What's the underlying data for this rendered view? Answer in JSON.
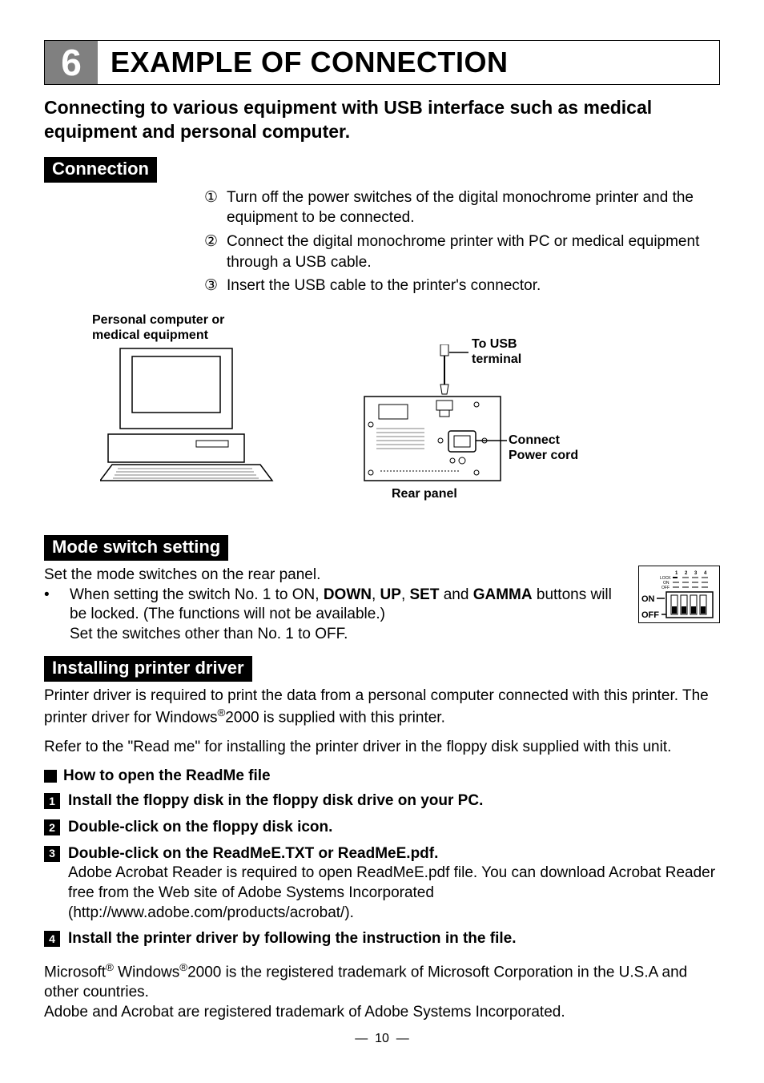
{
  "section": {
    "number": "6",
    "title": "EXAMPLE OF CONNECTION"
  },
  "subtitle": "Connecting to various equipment with USB interface such as medical equipment and personal computer.",
  "connection": {
    "label": "Connection",
    "steps": {
      "1": "Turn off the power switches of the digital monochrome printer and the equipment to be connected.",
      "2": "Connect the digital monochrome printer with PC or medical equipment through a USB cable.",
      "3": "Insert the USB cable to the printer's connector."
    },
    "diagram": {
      "pc_label_l1": "Personal computer or",
      "pc_label_l2": "medical equipment",
      "usb_label_l1": "To USB",
      "usb_label_l2": "terminal",
      "connect_label_l1": "Connect",
      "connect_label_l2": "Power cord",
      "rear_label": "Rear panel"
    }
  },
  "mode_switch": {
    "label": "Mode switch setting",
    "intro": "Set the mode switches on the rear panel.",
    "bullet_prefix": "When setting the switch No. 1 to ON, ",
    "b1": "DOWN",
    "sep1": ", ",
    "b2": "UP",
    "sep2": ", ",
    "b3": "SET",
    "sep3": " and ",
    "b4": "GAMMA",
    "bullet_rest1": " buttons will be locked. (The functions will not be available.)",
    "bullet_rest2": "Set the switches other than No. 1 to OFF.",
    "dip": {
      "n1": "1",
      "n2": "2",
      "n3": "3",
      "n4": "4",
      "lock": "LOCK",
      "on_row": "ON",
      "off_row": "OFF",
      "on": "ON",
      "off": "OFF"
    }
  },
  "install": {
    "label": "Installing printer driver",
    "p1_a": "Printer driver is required to print the data from a personal computer connected with this printer. The printer driver for Windows",
    "p1_sup": "®",
    "p1_b": "2000 is supplied with this printer.",
    "p2": "Refer to the \"Read me\" for installing the printer driver in the floppy disk supplied with this unit.",
    "howto": "How to open the ReadMe file",
    "steps": {
      "1": {
        "title": "Install the floppy disk in the floppy disk drive on your PC."
      },
      "2": {
        "title": "Double-click on the floppy disk icon."
      },
      "3": {
        "title": "Double-click on the ReadMeE.TXT or ReadMeE.pdf.",
        "desc": "Adobe Acrobat Reader is required to open ReadMeE.pdf file. You can download Acrobat Reader free from the Web site of Adobe Systems Incorporated (http://www.adobe.com/products/acrobat/)."
      },
      "4": {
        "title": "Install the printer driver by following the instruction in the file."
      }
    }
  },
  "trademark": {
    "p1_a": "Microsoft",
    "sup1": "®",
    "p1_b": " Windows",
    "sup2": "®",
    "p1_c": "2000 is the registered trademark of Microsoft Corporation in the U.S.A and other countries.",
    "p2": "Adobe and Acrobat are registered trademark of Adobe Systems Incorporated."
  },
  "page_number": "10"
}
